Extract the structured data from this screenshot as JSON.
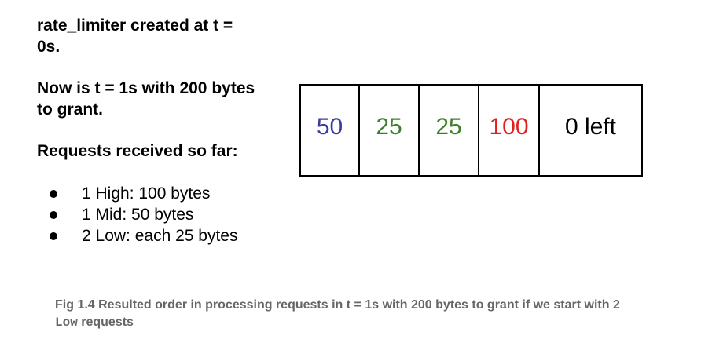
{
  "text": {
    "created": "rate_limiter created at t = 0s.",
    "now": "Now is t = 1s with 200 bytes to grant.",
    "requests_heading": "Requests received so far:",
    "requests": [
      "1 High: 100 bytes",
      "1 Mid: 50 bytes",
      "2 Low: each 25 bytes"
    ]
  },
  "slots": [
    {
      "label": "50",
      "color": "#3c3c9c"
    },
    {
      "label": "25",
      "color": "#3f7f2b"
    },
    {
      "label": "25",
      "color": "#3f7f2b"
    },
    {
      "label": "100",
      "color": "#e02020"
    },
    {
      "label": "0 left",
      "color": "#000000"
    }
  ],
  "caption": {
    "before": "Fig 1.4 Resulted order in processing requests in t = 1s with 200 bytes to grant if we start with 2",
    "code": "Low",
    "after": " requests"
  }
}
